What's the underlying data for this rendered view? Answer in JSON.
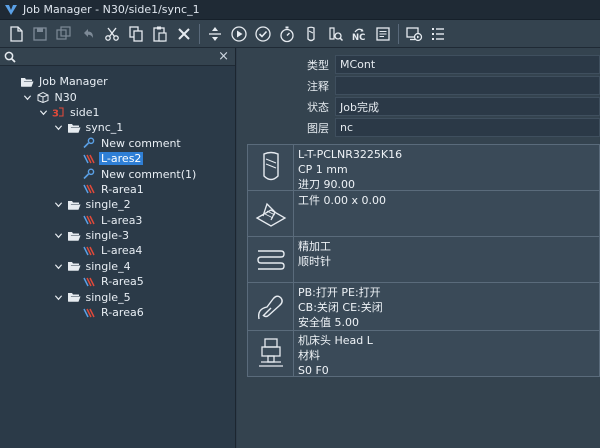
{
  "window": {
    "title": "Job Manager - N30/side1/sync_1"
  },
  "toolbar": {
    "groups": [
      [
        "new-file-icon",
        "save-icon",
        "save-all-icon",
        "undo-icon",
        "cut-icon",
        "copy-icon",
        "paste-icon",
        "delete-icon"
      ],
      [
        "expand-vertical-icon",
        "play-icon",
        "check-icon",
        "stopwatch-icon",
        "tool-icon",
        "inspect-icon",
        "nc-icon",
        "output-icon"
      ],
      [
        "simulate-icon",
        "list-icon"
      ]
    ],
    "nc_label": "NC"
  },
  "tree_panel": {
    "search_placeholder": "",
    "close_symbol": "×",
    "nodes": [
      {
        "label": "Job Manager",
        "depth": 0,
        "twisty": "none",
        "icon": "folder-open-icon",
        "selected": false
      },
      {
        "label": "N30",
        "depth": 1,
        "twisty": "open",
        "icon": "machine-icon",
        "selected": false
      },
      {
        "label": "side1",
        "depth": 2,
        "twisty": "open",
        "icon": "side-icon",
        "selected": false
      },
      {
        "label": "sync_1",
        "depth": 3,
        "twisty": "open",
        "icon": "folder-open-icon",
        "selected": false
      },
      {
        "label": "New comment",
        "depth": 4,
        "twisty": "none",
        "icon": "comment-icon",
        "selected": false
      },
      {
        "label": "L-ares2",
        "depth": 4,
        "twisty": "none",
        "icon": "operation-icon",
        "selected": true
      },
      {
        "label": "New comment(1)",
        "depth": 4,
        "twisty": "none",
        "icon": "comment-icon",
        "selected": false
      },
      {
        "label": "R-area1",
        "depth": 4,
        "twisty": "none",
        "icon": "operation-icon",
        "selected": false
      },
      {
        "label": "single_2",
        "depth": 3,
        "twisty": "open",
        "icon": "folder-open-icon",
        "selected": false
      },
      {
        "label": "L-area3",
        "depth": 4,
        "twisty": "none",
        "icon": "operation-icon",
        "selected": false
      },
      {
        "label": "single-3",
        "depth": 3,
        "twisty": "open",
        "icon": "folder-open-icon",
        "selected": false
      },
      {
        "label": "L-area4",
        "depth": 4,
        "twisty": "none",
        "icon": "operation-icon",
        "selected": false
      },
      {
        "label": "single_4",
        "depth": 3,
        "twisty": "open",
        "icon": "folder-open-icon",
        "selected": false
      },
      {
        "label": "R-area5",
        "depth": 4,
        "twisty": "none",
        "icon": "operation-icon",
        "selected": false
      },
      {
        "label": "single_5",
        "depth": 3,
        "twisty": "open",
        "icon": "folder-open-icon",
        "selected": false
      },
      {
        "label": "R-area6",
        "depth": 4,
        "twisty": "none",
        "icon": "operation-icon",
        "selected": false
      }
    ]
  },
  "properties": [
    {
      "key": "类型",
      "value": "MCont"
    },
    {
      "key": "注释",
      "value": ""
    },
    {
      "key": "状态",
      "value": "Job完成"
    },
    {
      "key": "图层",
      "value": "nc"
    }
  ],
  "cards": [
    {
      "icon": "tool-icon",
      "lines": [
        "L-T-PCLNR3225K16",
        "CP 1 mm",
        "进刀 90.00"
      ]
    },
    {
      "icon": "workpiece-icon",
      "lines": [
        "工件 0.00 x 0.00"
      ]
    },
    {
      "icon": "finish-icon",
      "lines": [
        "精加工",
        "顺时针"
      ]
    },
    {
      "icon": "path-icon",
      "lines": [
        "PB:打开 PE:打开",
        "CB:关闭 CE:关闭",
        "安全值 5.00"
      ]
    },
    {
      "icon": "machine-head-icon",
      "lines": [
        "机床头 Head L",
        "材料",
        "S0 F0"
      ]
    }
  ],
  "colors": {
    "selection": "#2f7fd6",
    "panel_bg": "#2b3a48",
    "toolbar_bg": "#34434f",
    "accent_red": "#e04a3a",
    "accent_blue": "#5aa0e6"
  }
}
